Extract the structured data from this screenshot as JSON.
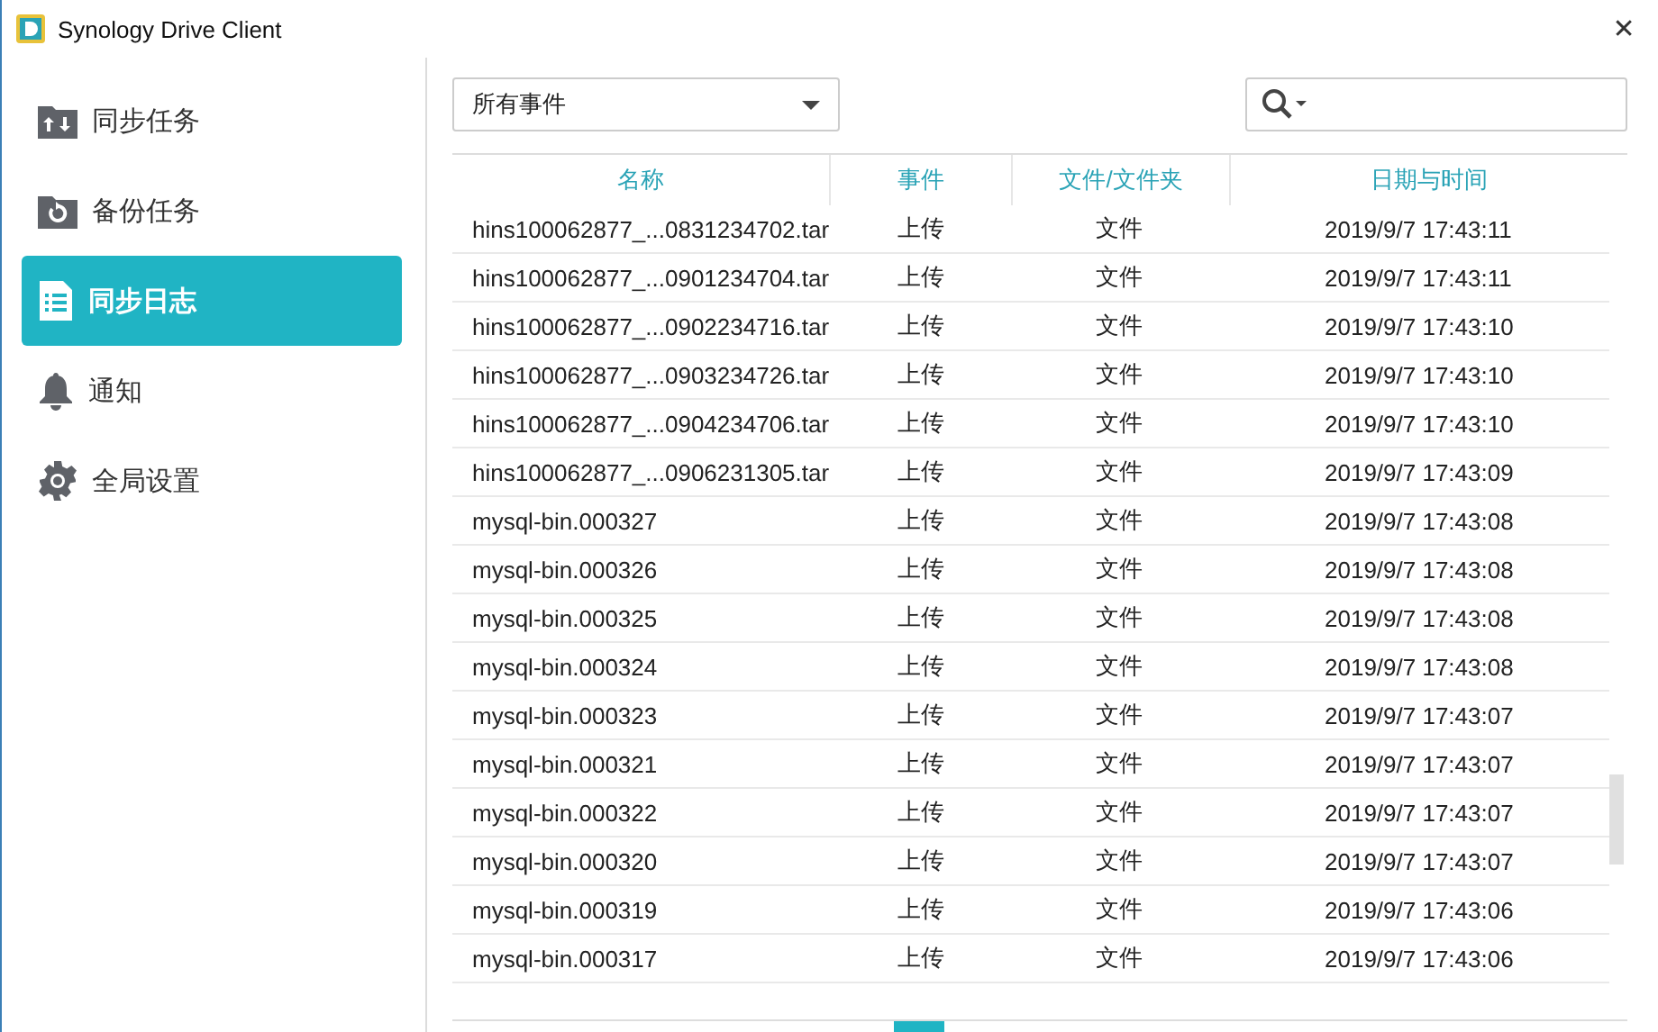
{
  "window": {
    "title": "Synology Drive Client",
    "close": "✕"
  },
  "sidebar": {
    "items": [
      {
        "label": "同步任务",
        "selected": false
      },
      {
        "label": "备份任务",
        "selected": false
      },
      {
        "label": "同步日志",
        "selected": true
      },
      {
        "label": "通知",
        "selected": false
      },
      {
        "label": "全局设置",
        "selected": false
      }
    ]
  },
  "filter": {
    "value": "所有事件"
  },
  "table": {
    "columns": [
      "名称",
      "事件",
      "文件/文件夹",
      "日期与时间"
    ],
    "rows": [
      [
        "hins100062877_...0831234702.tar",
        "上传",
        "文件",
        "2019/9/7 17:43:11"
      ],
      [
        "hins100062877_...0901234704.tar",
        "上传",
        "文件",
        "2019/9/7 17:43:11"
      ],
      [
        "hins100062877_...0902234716.tar",
        "上传",
        "文件",
        "2019/9/7 17:43:10"
      ],
      [
        "hins100062877_...0903234726.tar",
        "上传",
        "文件",
        "2019/9/7 17:43:10"
      ],
      [
        "hins100062877_...0904234706.tar",
        "上传",
        "文件",
        "2019/9/7 17:43:10"
      ],
      [
        "hins100062877_...0906231305.tar",
        "上传",
        "文件",
        "2019/9/7 17:43:09"
      ],
      [
        "mysql-bin.000327",
        "上传",
        "文件",
        "2019/9/7 17:43:08"
      ],
      [
        "mysql-bin.000326",
        "上传",
        "文件",
        "2019/9/7 17:43:08"
      ],
      [
        "mysql-bin.000325",
        "上传",
        "文件",
        "2019/9/7 17:43:08"
      ],
      [
        "mysql-bin.000324",
        "上传",
        "文件",
        "2019/9/7 17:43:08"
      ],
      [
        "mysql-bin.000323",
        "上传",
        "文件",
        "2019/9/7 17:43:07"
      ],
      [
        "mysql-bin.000321",
        "上传",
        "文件",
        "2019/9/7 17:43:07"
      ],
      [
        "mysql-bin.000322",
        "上传",
        "文件",
        "2019/9/7 17:43:07"
      ],
      [
        "mysql-bin.000320",
        "上传",
        "文件",
        "2019/9/7 17:43:07"
      ],
      [
        "mysql-bin.000319",
        "上传",
        "文件",
        "2019/9/7 17:43:06"
      ],
      [
        "mysql-bin.000317",
        "上传",
        "文件",
        "2019/9/7 17:43:06"
      ]
    ]
  }
}
